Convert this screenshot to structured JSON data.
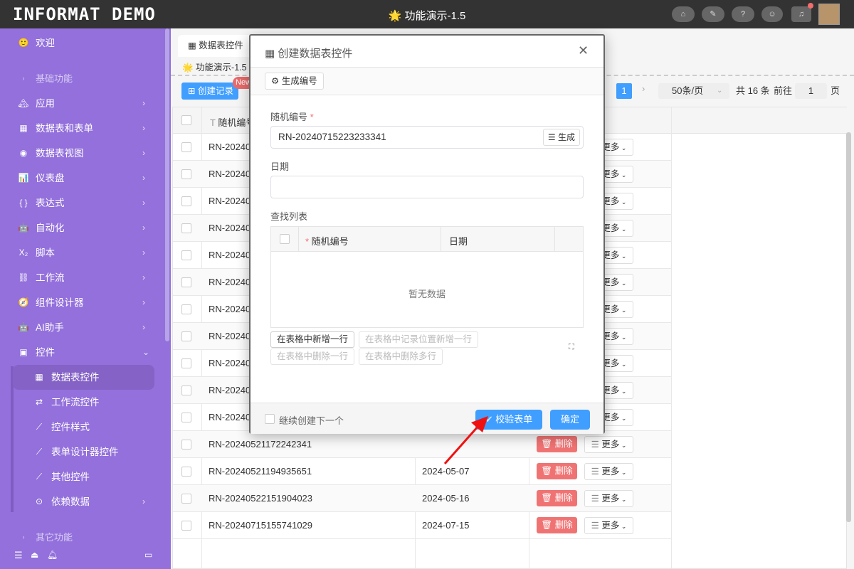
{
  "header": {
    "logo": "INFORMAT DEMO",
    "title": "🌟 功能演示-1.5",
    "icons": [
      "home-icon",
      "feedback-icon",
      "help-icon",
      "robot-icon",
      "bell-icon"
    ]
  },
  "sidebar": {
    "welcome": "欢迎",
    "group_basic": "基础功能",
    "items": [
      {
        "icon": "🏔",
        "label": "应用"
      },
      {
        "icon": "▦",
        "label": "数据表和表单"
      },
      {
        "icon": "◉",
        "label": "数据表视图"
      },
      {
        "icon": "📊",
        "label": "仪表盘"
      },
      {
        "icon": "{ }",
        "label": "表达式"
      },
      {
        "icon": "🤖",
        "label": "自动化"
      },
      {
        "icon": "X₂",
        "label": "脚本"
      },
      {
        "icon": "⛓",
        "label": "工作流"
      },
      {
        "icon": "🧭",
        "label": "组件设计器"
      },
      {
        "icon": "🤖",
        "label": "AI助手"
      },
      {
        "icon": "▣",
        "label": "控件"
      }
    ],
    "sub_items": [
      {
        "icon": "▦",
        "label": "数据表控件"
      },
      {
        "icon": "⇄",
        "label": "工作流控件"
      },
      {
        "icon": "⟋",
        "label": "控件样式"
      },
      {
        "icon": "⟋",
        "label": "表单设计器控件"
      },
      {
        "icon": "⟋",
        "label": "其他控件"
      },
      {
        "icon": "⊙",
        "label": "依赖数据"
      }
    ],
    "group_other": "其它功能"
  },
  "tab": {
    "label": "数据表控件"
  },
  "breadcrumb": "🌟 功能演示-1.5",
  "toolbar": {
    "create": "⊞ 创建记录",
    "new_badge": "New"
  },
  "pagination": {
    "current": "1",
    "page_size": "50条/页",
    "total": "共 16 条",
    "goto": "前往",
    "goto_value": "1",
    "page_suffix": "页"
  },
  "table": {
    "col_rn": "随机编号",
    "delete": "删除",
    "more": "更多",
    "rows": [
      [
        "RN-20240",
        ""
      ],
      [
        "RN-20240",
        ""
      ],
      [
        "RN-20240",
        ""
      ],
      [
        "RN-20240",
        ""
      ],
      [
        "RN-20240",
        ""
      ],
      [
        "RN-20240",
        ""
      ],
      [
        "RN-20240",
        ""
      ],
      [
        "RN-20240",
        ""
      ],
      [
        "RN-20240",
        ""
      ],
      [
        "RN-20240",
        ""
      ],
      [
        "RN-20240",
        ""
      ],
      [
        "RN-20240521172242341",
        ""
      ],
      [
        "RN-20240521194935651",
        "2024-05-07"
      ],
      [
        "RN-20240522151904023",
        "2024-05-16"
      ],
      [
        "RN-20240715155741029",
        "2024-07-15"
      ]
    ]
  },
  "modal": {
    "title": "创建数据表控件",
    "gen_number": "生成编号",
    "field_rn": "随机编号",
    "rn_value": "RN-20240715223233341",
    "gen": "生成",
    "field_date": "日期",
    "date_value": "",
    "field_lookup": "查找列表",
    "sub_col_rn": "随机编号",
    "sub_col_date": "日期",
    "empty": "暂无数据",
    "btn_add_row": "在表格中新增一行",
    "btn_add_at": "在表格中记录位置新增一行",
    "btn_del_row": "在表格中删除一行",
    "btn_del_rows": "在表格中删除多行",
    "continue": "继续创建下一个",
    "validate": "校验表单",
    "confirm": "确定"
  },
  "colors": {
    "sidebar": "#9370db",
    "primary": "#409eff",
    "danger": "#f07373",
    "header": "#333333"
  }
}
